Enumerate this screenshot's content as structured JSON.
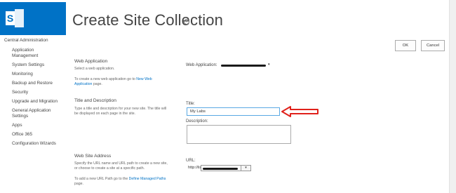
{
  "header": {
    "title": "Create Site Collection",
    "info_glyph": "i",
    "brand_color": "#0072c6"
  },
  "sidebar": {
    "header": "Central Administration",
    "items": [
      {
        "label": "Application"
      },
      {
        "label": "Management"
      },
      {
        "label": "System Settings"
      },
      {
        "label": "Monitoring"
      },
      {
        "label": "Backup and Restore"
      },
      {
        "label": "Security"
      },
      {
        "label": "Upgrade and Migration"
      },
      {
        "label": "General Application"
      },
      {
        "label": "Settings"
      },
      {
        "label": "Apps"
      },
      {
        "label": "Office 365"
      },
      {
        "label": "Configuration Wizards"
      }
    ]
  },
  "buttons": {
    "ok": "OK",
    "cancel": "Cancel"
  },
  "sections": {
    "web_application": {
      "title": "Web Application",
      "desc": "Select a web application.",
      "note_prefix": "To create a new web application go to ",
      "note_link1": "New Web",
      "note_link2": "Application",
      "note_suffix": " page."
    },
    "title_description": {
      "title": "Title and Description",
      "desc_line1": "Type a title and description for your new site. The title will",
      "desc_line2": "be displayed on each page in the site."
    },
    "web_site_address": {
      "title": "Web Site Address",
      "desc_line1": "Specify the URL name and URL path to create a new site,",
      "desc_line2": "or choose to create a site at a specific path.",
      "note_prefix": "To add a new URL Path go to the ",
      "note_link": "Define Managed Paths",
      "note_suffix": "page."
    }
  },
  "form": {
    "web_app_label": "Web Application:",
    "title_label": "Title:",
    "title_value": "My Labs",
    "description_label": "Description:",
    "url_label": "URL:",
    "url_prefix": "http://lis",
    "url_select_glyph": "▾"
  },
  "colors": {
    "annotation_arrow": "#e0211b",
    "link": "#0072c6",
    "input_focus_border": "#5aa9e4"
  },
  "icons": {
    "logo": "sharepoint-logo-icon",
    "info": "info-icon",
    "arrow": "red-arrow-icon",
    "dropdown": "chevron-down-icon"
  }
}
